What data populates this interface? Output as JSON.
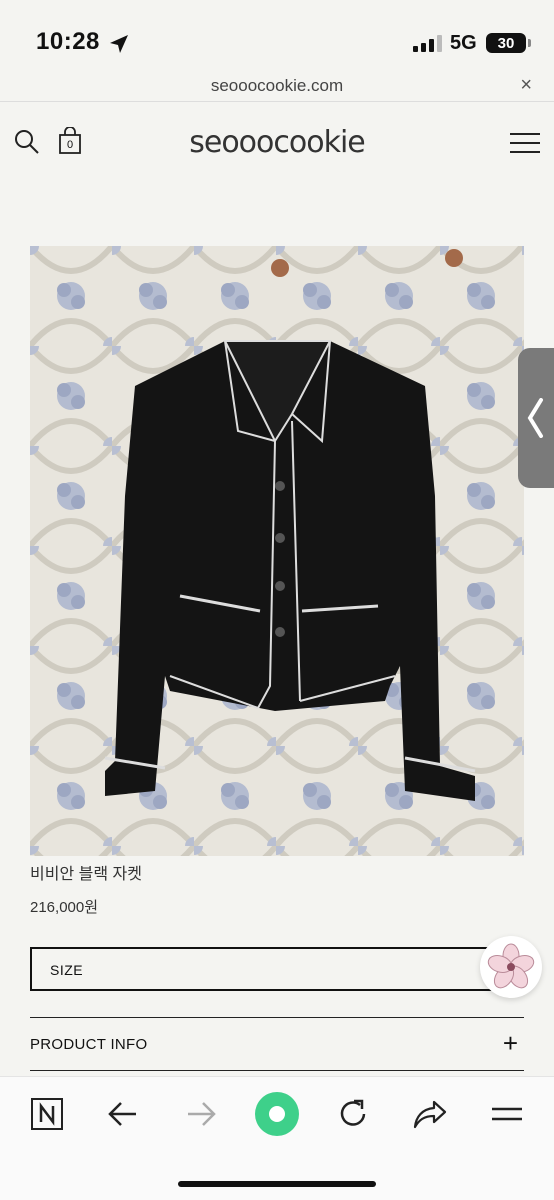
{
  "status_bar": {
    "time": "10:28",
    "network": "5G",
    "battery": "30"
  },
  "browser": {
    "url": "seooocookie.com",
    "close_glyph": "×"
  },
  "site": {
    "logo": "seooocookie",
    "cart_count": "0"
  },
  "product": {
    "name": "비비안 블랙 자켓",
    "price": "216,000원",
    "size_label": "SIZE",
    "info_label": "PRODUCT INFO",
    "info_toggle": "+"
  },
  "colors": {
    "background": "#f4f4f1",
    "accent_green": "#3ed08a",
    "jacket": "#141414"
  },
  "icons": {
    "header": [
      "search-icon",
      "shopping-bag-icon",
      "hamburger-menu-icon"
    ],
    "toolbar": [
      "naver-home-icon",
      "back-arrow-icon",
      "forward-arrow-icon",
      "green-dot-icon",
      "reload-icon",
      "share-icon",
      "menu-icon"
    ]
  }
}
